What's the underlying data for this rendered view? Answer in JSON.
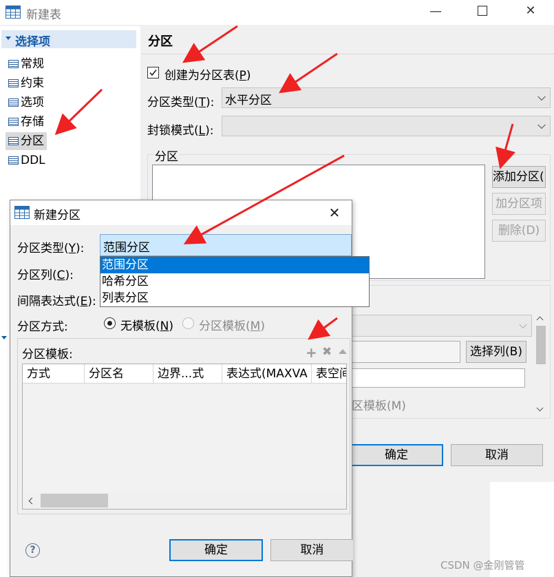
{
  "main_window": {
    "title": "新建表",
    "close_glyph": "✕",
    "max_glyph": "☐",
    "min_glyph": "—"
  },
  "sidebar": {
    "header": "选择项",
    "items": [
      {
        "label": "常规"
      },
      {
        "label": "约束"
      },
      {
        "label": "选项"
      },
      {
        "label": "存储"
      },
      {
        "label": "分区"
      },
      {
        "label": "DDL"
      }
    ],
    "selected_index": 4
  },
  "partition_page": {
    "title": "分区",
    "create_checkbox": {
      "label_pre": "创建为分区表(",
      "mnemonic": "P",
      "label_post": ")",
      "checked": true
    },
    "type_label": {
      "pre": "分区类型(",
      "mnemonic": "T",
      "post": "):"
    },
    "type_value": "水平分区",
    "lock_label": {
      "pre": "封锁模式(",
      "mnemonic": "L",
      "post": "):"
    },
    "lock_value": "",
    "group_label": "分区",
    "add_partition": "添加分区(L",
    "add_item": "加分区项",
    "delete": "删除(D)",
    "select_column": "选择列(B)",
    "partition_template_frag": "区模板(M)",
    "ok": "确定",
    "cancel": "取消"
  },
  "dialog": {
    "title": "新建分区",
    "type_label": {
      "pre": "分区类型(",
      "mnemonic": "Y",
      "post": "):"
    },
    "type_value": "范围分区",
    "column_label": {
      "pre": "分区列(",
      "mnemonic": "C",
      "post": "):"
    },
    "interval_label": {
      "pre": "间隔表达式(",
      "mnemonic": "E",
      "post": "):"
    },
    "method_label": "分区方式:",
    "radio_no_template": {
      "pre": "无模板(",
      "mnemonic": "N",
      "post": ")",
      "checked": true
    },
    "radio_template": {
      "pre": "分区模板(",
      "mnemonic": "M",
      "post": ")",
      "checked": false
    },
    "template_group": "分区模板:",
    "columns": [
      "方式",
      "分区名",
      "边界...式",
      "表达式(MAXVA",
      "表空间"
    ],
    "dropdown_options": [
      "范围分区",
      "哈希分区",
      "列表分区"
    ],
    "dropdown_selected": 0,
    "ok": "确定",
    "cancel": "取消",
    "help_glyph": "?"
  },
  "watermark": "CSDN @金刚管管",
  "colors": {
    "accent": "#0078d7",
    "selection_bg": "#cce8ff",
    "arrow_red": "#ee2222"
  }
}
